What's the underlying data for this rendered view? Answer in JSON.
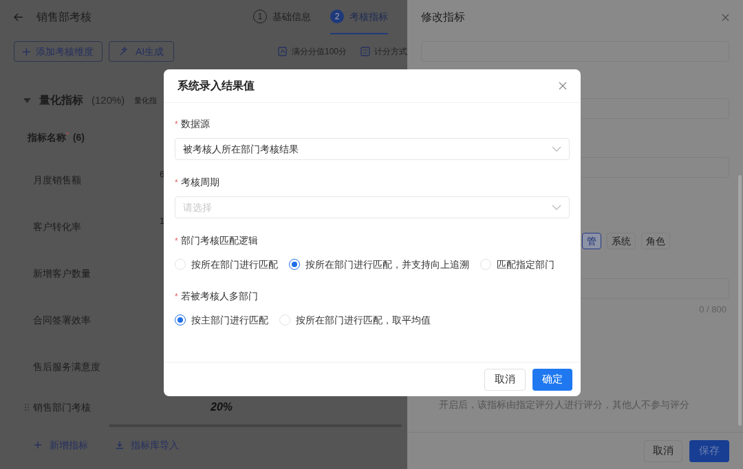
{
  "page": {
    "title": "销售部考核",
    "steps": [
      {
        "number": "1",
        "label": "基础信息",
        "selected": false
      },
      {
        "number": "2",
        "label": "考核指标",
        "selected": true
      }
    ],
    "toolbar": {
      "add_button": "添加考核维度",
      "ai_button": "AI生成",
      "full_score": "满分分值100分",
      "scoring": "计分方式"
    },
    "section": {
      "title": "量化指标",
      "weight": "(120%)",
      "column_2": "量化指"
    },
    "table": {
      "header": "指标名称",
      "required": "*",
      "count": "(6)",
      "rows": [
        {
          "name": "月度销售额",
          "column_2": "6"
        },
        {
          "name": "客户转化率",
          "column_2": "1"
        },
        {
          "name": "新增客户数量"
        },
        {
          "name": "合同签署效率"
        },
        {
          "name": "售后服务满意度"
        },
        {
          "name": "销售部门考核",
          "weight": "20%"
        }
      ]
    },
    "footer": {
      "add": "新增指标",
      "import": "指标库导入"
    }
  },
  "drawer": {
    "title": "修改指标",
    "tags": [
      {
        "label": "管",
        "selected": true
      },
      {
        "label": "系统",
        "selected": false
      },
      {
        "label": "角色",
        "selected": false
      }
    ],
    "counter": "0 / 800",
    "hint": "开启后，该指标由指定评分人进行评分，其他人不参与评分",
    "cancel": "取消",
    "save": "保存"
  },
  "dialog": {
    "title": "系统录入结果值",
    "fields": [
      {
        "kind": "select",
        "label": "数据源",
        "required": true,
        "value": "被考核人所在部门考核结果"
      },
      {
        "kind": "select",
        "label": "考核周期",
        "required": true,
        "placeholder": "请选择"
      },
      {
        "kind": "radio",
        "label": "部门考核匹配逻辑",
        "required": true,
        "options": [
          {
            "label": "按所在部门进行匹配",
            "selected": false
          },
          {
            "label": "按所在部门进行匹配，并支持向上追溯",
            "selected": true
          },
          {
            "label": "匹配指定部门",
            "selected": false
          }
        ]
      },
      {
        "kind": "radio",
        "label": "若被考核人多部门",
        "required": true,
        "options": [
          {
            "label": "按主部门进行匹配",
            "selected": true
          },
          {
            "label": "按所在部门进行匹配，取平均值",
            "selected": false
          }
        ]
      }
    ],
    "cancel": "取消",
    "ok": "确定"
  }
}
